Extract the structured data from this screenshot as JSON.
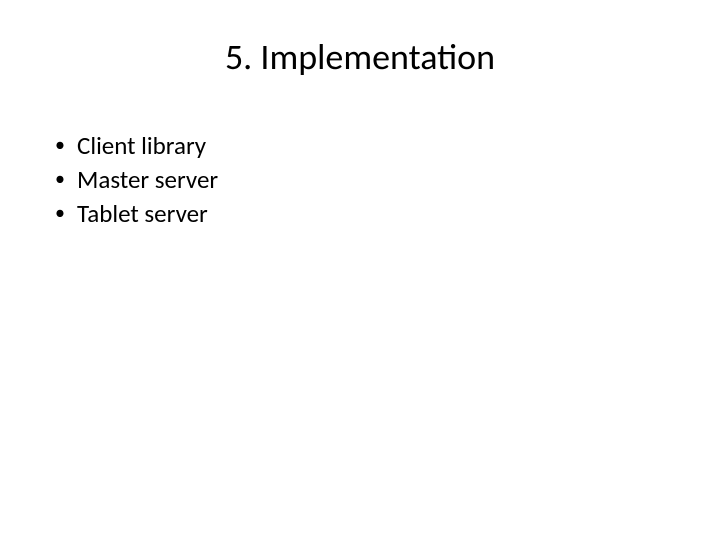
{
  "title": "5. Implementation",
  "bullets": [
    "Client library",
    "Master server",
    "Tablet server"
  ]
}
